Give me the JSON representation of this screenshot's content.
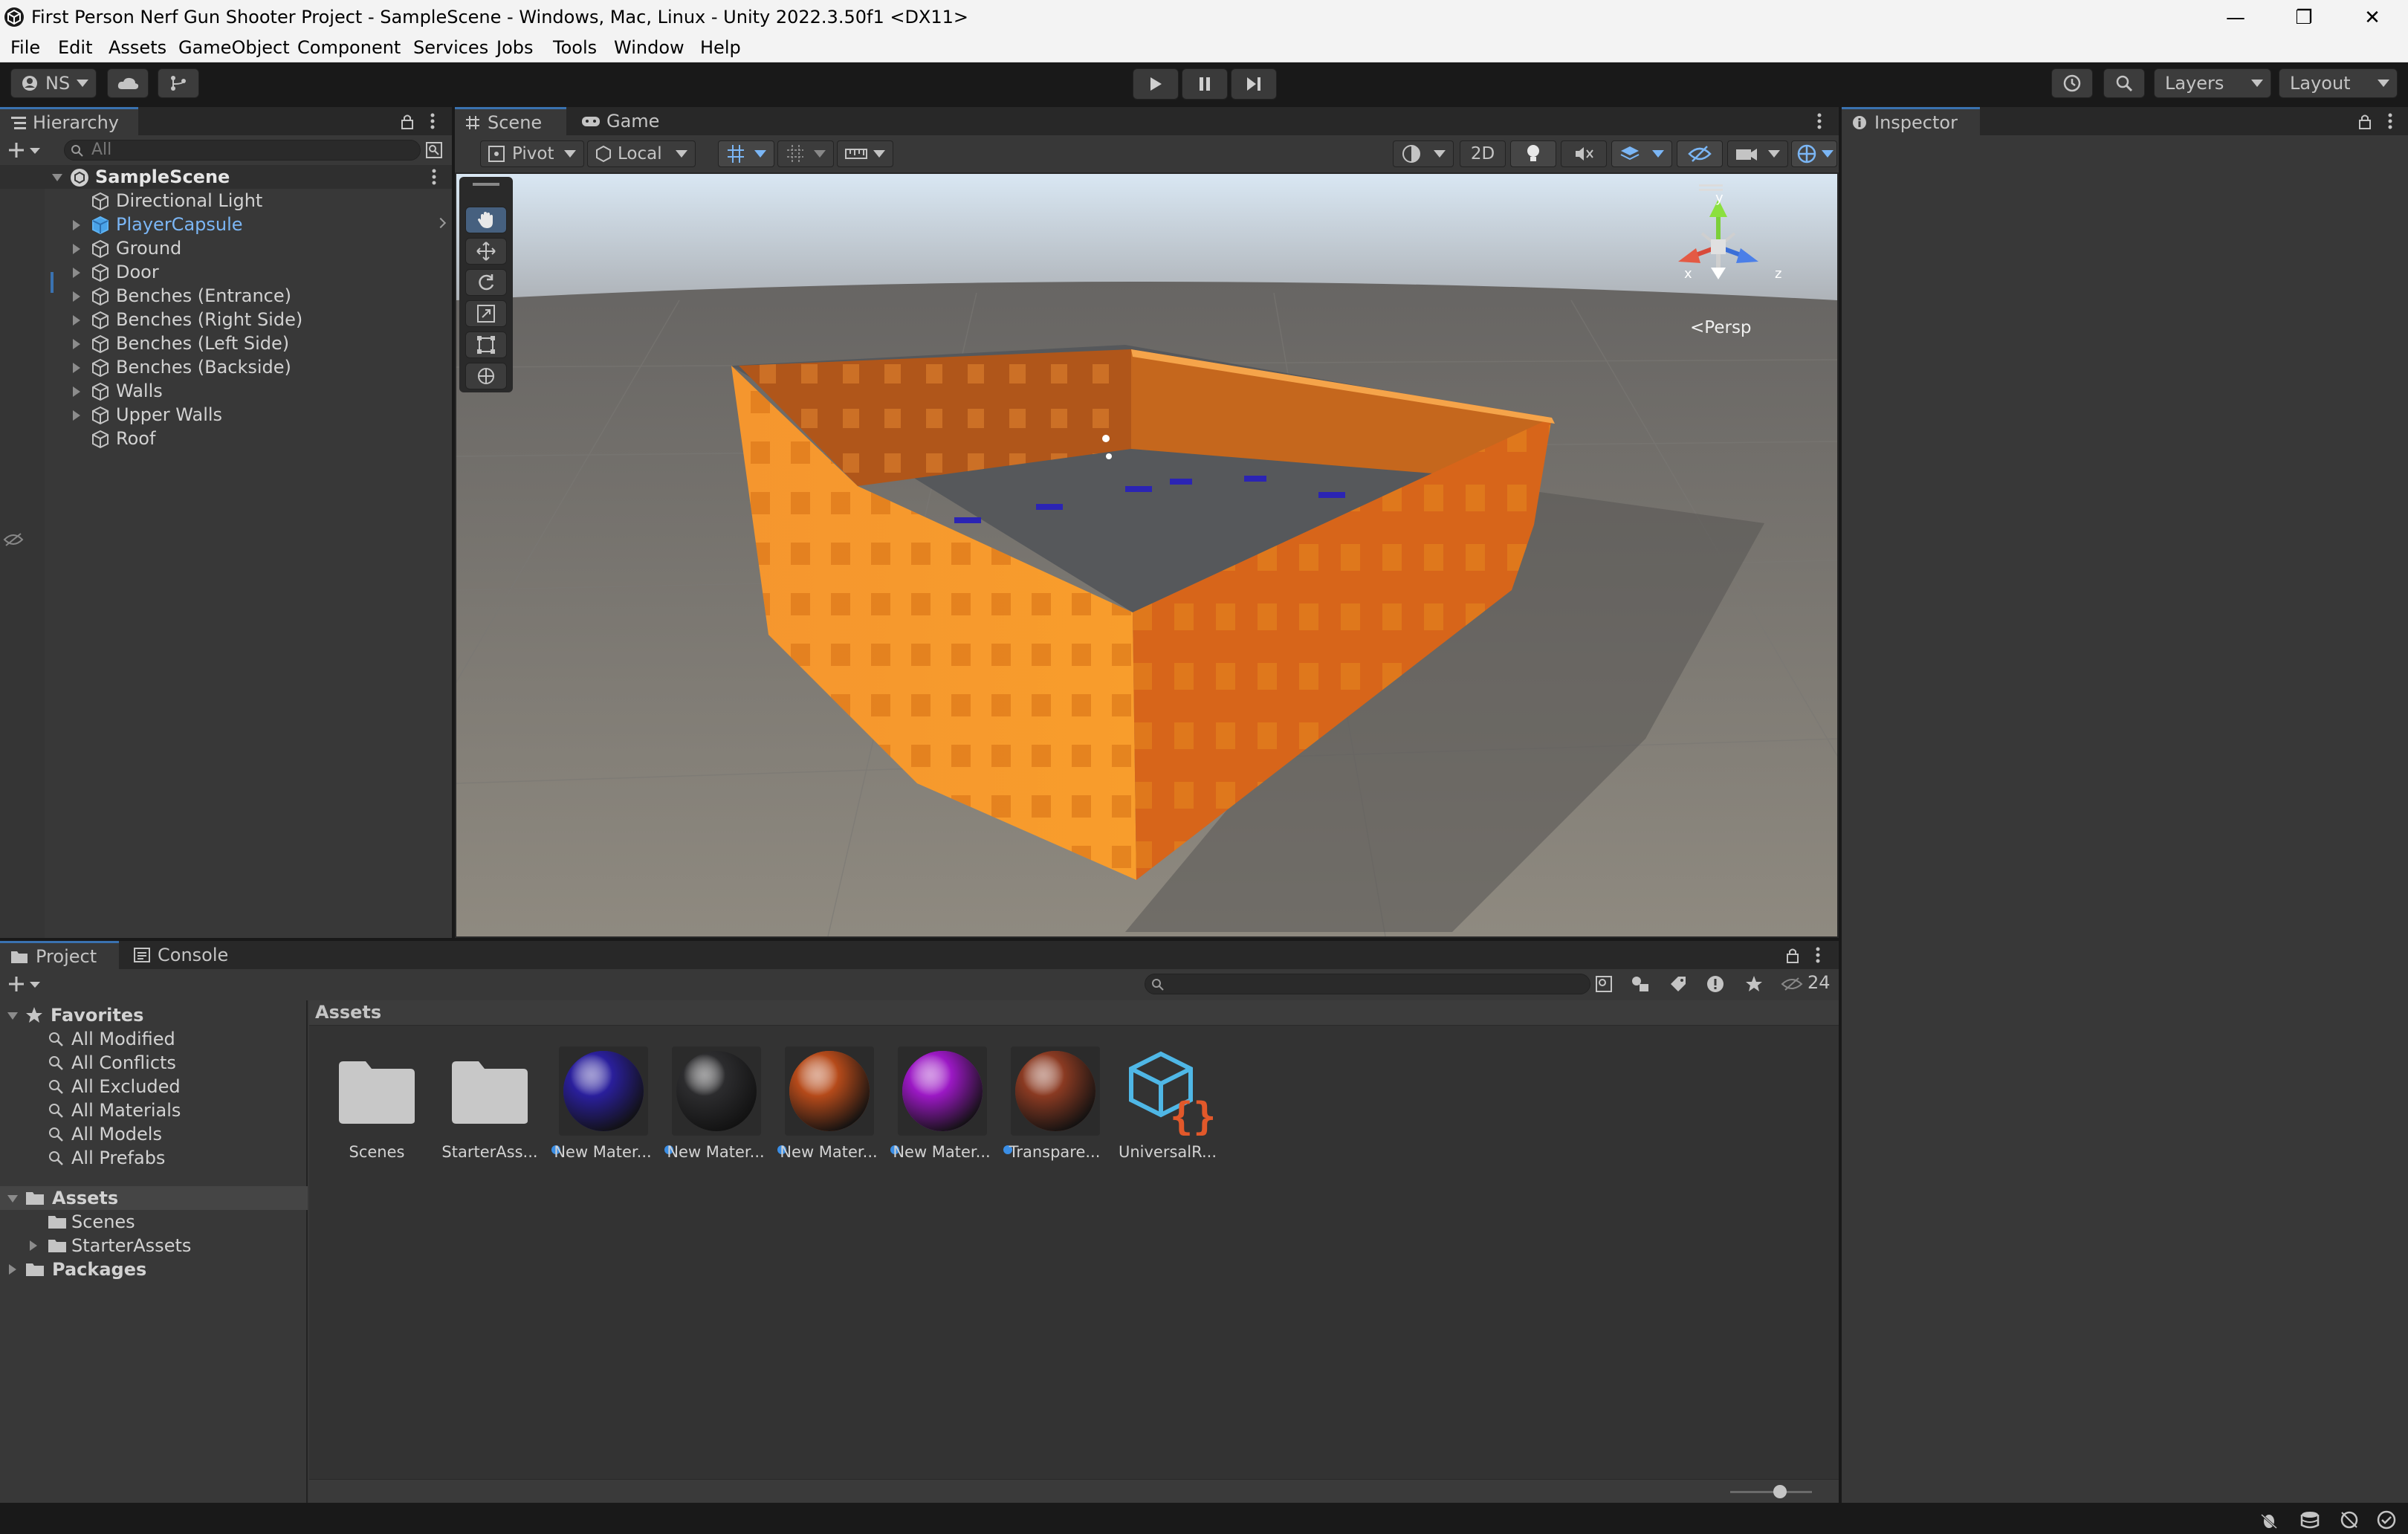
{
  "window": {
    "title": "First Person Nerf Gun Shooter Project - SampleScene - Windows, Mac, Linux - Unity 2022.3.50f1 <DX11>",
    "minimize": "—",
    "maximize": "❐",
    "close": "✕"
  },
  "menu": [
    "File",
    "Edit",
    "Assets",
    "GameObject",
    "Component",
    "Services",
    "Jobs",
    "Tools",
    "Window",
    "Help"
  ],
  "toolbar": {
    "account_label": "NS",
    "layers_label": "Layers",
    "layout_label": "Layout"
  },
  "hierarchy": {
    "tab_label": "Hierarchy",
    "search_placeholder": "All",
    "scene_name": "SampleScene",
    "items": [
      {
        "label": "Directional Light",
        "expandable": false,
        "selected": false
      },
      {
        "label": "PlayerCapsule",
        "expandable": true,
        "selected": true
      },
      {
        "label": "Ground",
        "expandable": true,
        "selected": false
      },
      {
        "label": "Door",
        "expandable": true,
        "selected": false
      },
      {
        "label": "Benches (Entrance)",
        "expandable": true,
        "selected": false
      },
      {
        "label": "Benches (Right Side)",
        "expandable": true,
        "selected": false
      },
      {
        "label": "Benches (Left Side)",
        "expandable": true,
        "selected": false
      },
      {
        "label": "Benches (Backside)",
        "expandable": true,
        "selected": false
      },
      {
        "label": "Walls",
        "expandable": true,
        "selected": false
      },
      {
        "label": "Upper Walls",
        "expandable": true,
        "selected": false
      },
      {
        "label": "Roof",
        "expandable": false,
        "selected": false
      }
    ]
  },
  "scene": {
    "tabs": [
      "Scene",
      "Game"
    ],
    "pivot_label": "Pivot",
    "local_label": "Local",
    "mode_2d_label": "2D",
    "persp_label": "Persp",
    "gizmo_axes": {
      "x": "x",
      "y": "y",
      "z": "z"
    }
  },
  "inspector": {
    "tab_label": "Inspector"
  },
  "project": {
    "tabs": [
      "Project",
      "Console"
    ],
    "hidden_count": "24",
    "breadcrumb": "Assets",
    "favorites_label": "Favorites",
    "favorites": [
      "All Modified",
      "All Conflicts",
      "All Excluded",
      "All Materials",
      "All Models",
      "All Prefabs"
    ],
    "tree": {
      "assets_label": "Assets",
      "children": [
        "Scenes",
        "StarterAssets"
      ],
      "packages_label": "Packages"
    },
    "assets": [
      {
        "name": "Scenes",
        "kind": "folder"
      },
      {
        "name": "StarterAss...",
        "kind": "folder"
      },
      {
        "name": "New Mater...",
        "kind": "material",
        "color": "#2a1f9c"
      },
      {
        "name": "New Mater...",
        "kind": "material",
        "color": "#2c2c2e"
      },
      {
        "name": "New Mater...",
        "kind": "material",
        "color": "#b54a1a"
      },
      {
        "name": "New Mater...",
        "kind": "material",
        "color": "#9b18c4"
      },
      {
        "name": "Transpare...",
        "kind": "material",
        "color": "#8a3a22"
      },
      {
        "name": "UniversalR...",
        "kind": "pipeline"
      }
    ]
  },
  "colors": {
    "accent_blue": "#3a72b0",
    "selected_text": "#7bb6f5",
    "wall_orange": "#f38b26"
  }
}
